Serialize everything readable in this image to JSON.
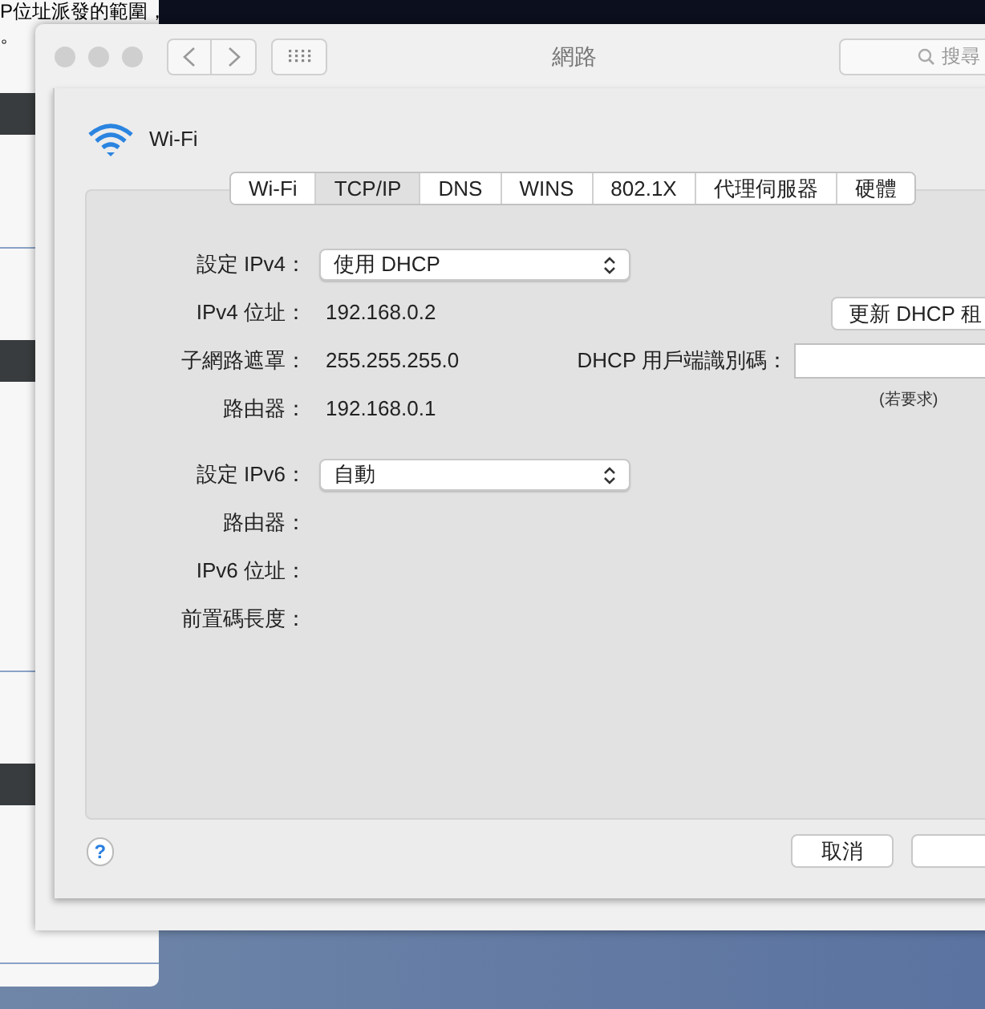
{
  "background_document": {
    "lines": [
      "P位址派發的範圍，",
      "。"
    ]
  },
  "window": {
    "title": "網路",
    "search": {
      "placeholder": "搜尋"
    }
  },
  "interface": {
    "name": "Wi-Fi"
  },
  "tabs": [
    {
      "label": "Wi-Fi",
      "selected": false
    },
    {
      "label": "TCP/IP",
      "selected": true
    },
    {
      "label": "DNS",
      "selected": false
    },
    {
      "label": "WINS",
      "selected": false
    },
    {
      "label": "802.1X",
      "selected": false
    },
    {
      "label": "代理伺服器",
      "selected": false
    },
    {
      "label": "硬體",
      "selected": false
    }
  ],
  "ipv4": {
    "configure": {
      "label": "設定 IPv4：",
      "value": "使用 DHCP"
    },
    "rows": [
      {
        "label": "IPv4 位址：",
        "value": "192.168.0.2"
      },
      {
        "label": "子網路遮罩：",
        "value": "255.255.255.0"
      },
      {
        "label": "路由器：",
        "value": "192.168.0.1"
      }
    ],
    "renew_button": "更新 DHCP 租",
    "client_id": {
      "label": "DHCP 用戶端識別碼：",
      "hint": "(若要求)"
    }
  },
  "ipv6": {
    "configure": {
      "label": "設定 IPv6：",
      "value": "自動"
    },
    "rows": [
      {
        "label": "路由器："
      },
      {
        "label": "IPv6 位址："
      },
      {
        "label": "前置碼長度："
      }
    ]
  },
  "help_button": "?",
  "buttons": [
    "取消"
  ]
}
